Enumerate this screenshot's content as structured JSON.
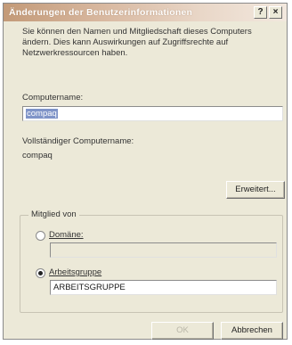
{
  "dialog": {
    "title": "Änderungen der Benutzerinformationen",
    "help_glyph": "?",
    "close_glyph": "×",
    "intro": "Sie können den Namen und Mitgliedschaft dieses Computers ändern. Dies kann Auswirkungen auf Zugriffsrechte auf Netzwerkressourcen haben.",
    "computer_name": {
      "label": "Computername:",
      "value": "compaq"
    },
    "full_name": {
      "label": "Vollständiger Computername:",
      "value": "compaq"
    },
    "more_button": "Erweitert...",
    "member_of": {
      "legend": "Mitglied von",
      "domain": {
        "label": "Domäne:",
        "value": "",
        "selected": false
      },
      "workgroup": {
        "label": "Arbeitsgruppe",
        "value": "ARBEITSGRUPPE",
        "selected": true
      }
    },
    "ok_button": "OK",
    "cancel_button": "Abbrechen"
  }
}
